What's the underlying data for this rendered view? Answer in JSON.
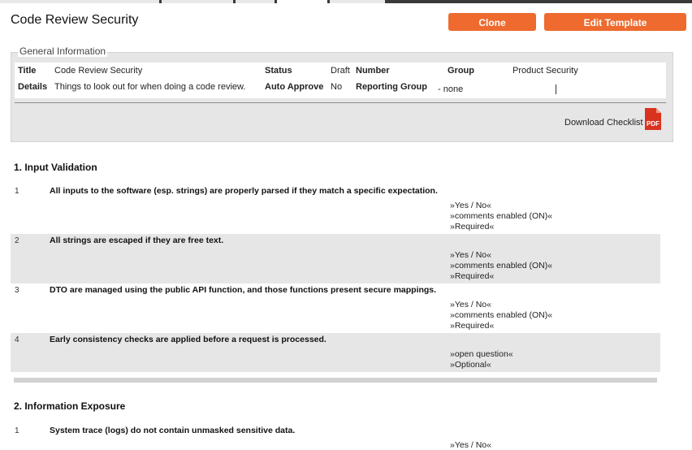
{
  "header": {
    "title": "Code Review Security",
    "clone_label": "Clone",
    "edit_label": "Edit Template"
  },
  "general_info": {
    "legend": "General Information",
    "title_label": "Title",
    "title_value": "Code Review Security",
    "status_label": "Status",
    "status_value": "Draft",
    "number_label": "Number",
    "group_label": "Group",
    "group_value": "Product Security",
    "details_label": "Details",
    "details_value": "Things to look out for when doing a code review.",
    "auto_approve_label": "Auto Approve",
    "auto_approve_value": "No",
    "reporting_group_label": "Reporting Group",
    "reporting_group_value": "- none",
    "download_label": "Download Checklist",
    "pdf_icon_text": "PDF"
  },
  "sections": [
    {
      "title": "1. Input Validation",
      "items": [
        {
          "num": "1",
          "question": "All inputs to the software (esp. strings) are properly parsed if they match a specific expectation.",
          "options": [
            "»Yes / No«",
            "»comments enabled (ON)«",
            "»Required«"
          ]
        },
        {
          "num": "2",
          "question": "All strings are escaped if they are free text.",
          "options": [
            "»Yes / No«",
            "»comments enabled (ON)«",
            "»Required«"
          ]
        },
        {
          "num": "3",
          "question": "DTO are managed using the public API function, and those functions present secure mappings.",
          "options": [
            "»Yes / No«",
            "»comments enabled (ON)«",
            "»Required«"
          ]
        },
        {
          "num": "4",
          "question": "Early consistency checks are applied before a request is processed.",
          "options": [
            "»open question«",
            "»Optional«"
          ]
        }
      ]
    },
    {
      "title": "2. Information Exposure",
      "items": [
        {
          "num": "1",
          "question": "System trace (logs) do not contain unmasked sensitive data.",
          "options": [
            "»Yes / No«"
          ]
        }
      ]
    }
  ],
  "colors": {
    "accent": "#ee6a2e",
    "panel": "#e6e6e6",
    "pdf_red": "#d9321f"
  }
}
